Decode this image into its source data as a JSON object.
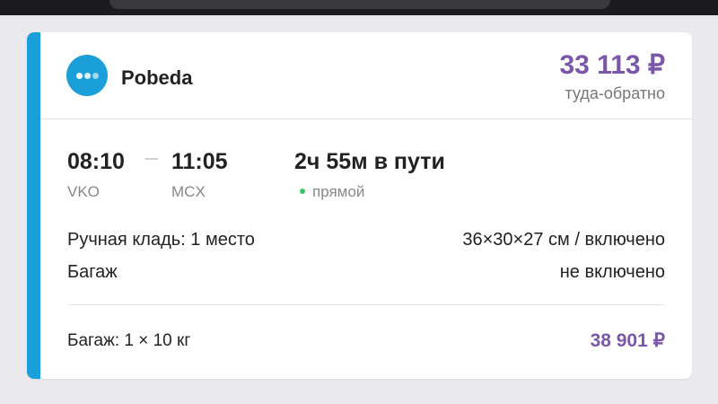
{
  "flight_card": {
    "airline": {
      "name": "Pobeda",
      "logo_color": "#1a9fd8"
    },
    "price": {
      "amount": "33 113 ₽",
      "note": "туда-обратно",
      "color": "#7a57a8"
    },
    "segment": {
      "departure_time": "08:10",
      "arrival_time": "11:05",
      "departure_code": "VKO",
      "arrival_code": "MCX",
      "duration": "2ч 55м в пути",
      "stops": "прямой",
      "stops_indicator_color": "#3ec36b"
    },
    "baggage": {
      "carry_on_label": "Ручная кладь: 1 место",
      "carry_on_value": "36×30×27 см / включено",
      "checked_label": "Багаж",
      "checked_value": "не включено"
    },
    "option": {
      "label": "Багаж: 1 × 10 кг",
      "price": "38 901 ₽"
    },
    "accent_color": "#1a9fd8"
  }
}
